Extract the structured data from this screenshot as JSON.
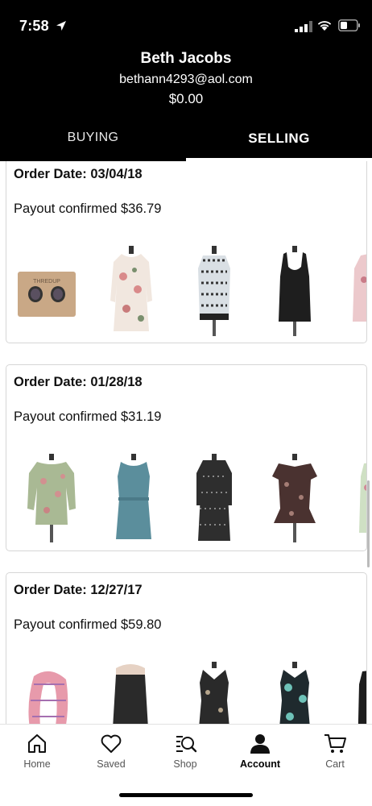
{
  "status_bar": {
    "time": "7:58"
  },
  "profile": {
    "name": "Beth Jacobs",
    "email": "bethann4293@aol.com",
    "balance": "$0.00"
  },
  "tabs": [
    {
      "label": "BUYING",
      "active": false
    },
    {
      "label": "SELLING",
      "active": true
    }
  ],
  "orders": [
    {
      "date": "Order Date: 03/04/18",
      "payout": "Payout confirmed $36.79",
      "items": [
        "earrings-on-card",
        "floral-dress",
        "print-top",
        "black-tank-top",
        "pink-floral-top"
      ]
    },
    {
      "date": "Order Date: 01/28/18",
      "payout": "Payout confirmed $31.19",
      "items": [
        "green-floral-blouse",
        "teal-dress",
        "black-print-dress",
        "brown-ruffle-top",
        "floral-item"
      ]
    },
    {
      "date": "Order Date: 12/27/17",
      "payout": "Payout confirmed $59.80",
      "items": [
        "pink-scarf",
        "black-skirt",
        "black-floral-dress",
        "teal-floral-dress",
        "black-top"
      ]
    }
  ],
  "item_labels": {
    "earrings_card_text": "THREDUP"
  },
  "bottom_nav": [
    {
      "label": "Home",
      "icon": "home-icon",
      "active": false
    },
    {
      "label": "Saved",
      "icon": "heart-icon",
      "active": false
    },
    {
      "label": "Shop",
      "icon": "shop-search-icon",
      "active": false
    },
    {
      "label": "Account",
      "icon": "account-icon",
      "active": true
    },
    {
      "label": "Cart",
      "icon": "cart-icon",
      "active": false
    }
  ],
  "colors": {
    "header_bg": "#000000",
    "accent": "#000000"
  }
}
